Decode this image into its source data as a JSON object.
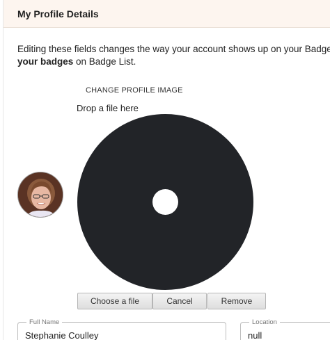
{
  "header": {
    "title": "My Profile Details"
  },
  "description": {
    "line1": "Editing these fields changes the way your account shows up on your Badge List",
    "bold": "your badges",
    "rest": " on Badge List."
  },
  "image_upload": {
    "heading": "CHANGE PROFILE IMAGE",
    "drop_text": "Drop a file here"
  },
  "buttons": {
    "choose": "Choose a file",
    "cancel": "Cancel",
    "remove": "Remove"
  },
  "fields": {
    "full_name": {
      "label": "Full Name",
      "value": "Stephanie Coulley"
    },
    "location": {
      "label": "Location",
      "value": "null"
    }
  }
}
